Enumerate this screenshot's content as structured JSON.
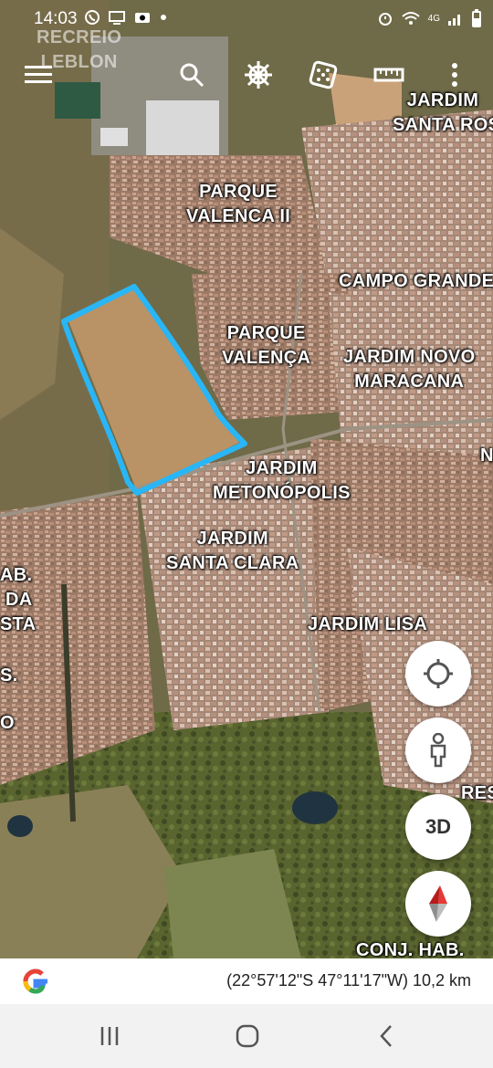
{
  "status_bar": {
    "time": "14:03",
    "left_icons": [
      "whatsapp-icon",
      "cast-icon",
      "camera-icon",
      "dot-icon"
    ],
    "right_icons": [
      "alarm-icon",
      "wifi-icon",
      "4g-signal-icon",
      "signal-icon",
      "battery-icon"
    ],
    "network": "4G"
  },
  "toolbar": {
    "items": [
      "menu-icon",
      "search-icon",
      "voyager-wheel-icon",
      "feeling-lucky-dice-icon",
      "measure-ruler-icon",
      "more-vert-icon"
    ]
  },
  "map_labels": [
    {
      "id": "recreio-leblon",
      "lines": [
        "RECREIO",
        "LEBLON"
      ]
    },
    {
      "id": "jardim-santa-rosa",
      "lines": [
        "JARDIM",
        "SANTA ROS"
      ]
    },
    {
      "id": "parque-valenca-ii",
      "lines": [
        "PARQUE",
        "VALENCA II"
      ]
    },
    {
      "id": "campo-grande",
      "lines": [
        "CAMPO GRANDE"
      ]
    },
    {
      "id": "parque-valenca",
      "lines": [
        "PARQUE",
        "VALENÇA"
      ]
    },
    {
      "id": "jardim-novo-maracana",
      "lines": [
        "JARDIM NOVO",
        "MARACANA"
      ]
    },
    {
      "id": "n-right",
      "lines": [
        "N"
      ]
    },
    {
      "id": "jardim-metonopolis",
      "lines": [
        "JARDIM",
        "METONÓPOLIS"
      ]
    },
    {
      "id": "jardim-santa-clara",
      "lines": [
        "JARDIM",
        "SANTA CLARA"
      ]
    },
    {
      "id": "hab-da-sta",
      "lines": [
        "AB.",
        "DA",
        "STA"
      ]
    },
    {
      "id": "jardim-lisa",
      "lines": [
        "JARDIM LISA"
      ]
    },
    {
      "id": "s-left",
      "lines": [
        "S."
      ]
    },
    {
      "id": "o-left",
      "lines": [
        "O"
      ]
    },
    {
      "id": "res-right",
      "lines": [
        "RES"
      ]
    },
    {
      "id": "conj-hab",
      "lines": [
        "CONJ. HAB."
      ]
    }
  ],
  "controls": {
    "locate": "crosshair-icon",
    "street_view": "pegman-icon",
    "view_3d": "3D",
    "compass": "compass-icon"
  },
  "info_bar": {
    "logo": "google-g-logo",
    "coordinates": "(22°57'12\"S 47°11'17\"W) 10,2 km"
  },
  "nav_bar": {
    "buttons": [
      "recent-apps-icon",
      "home-icon",
      "back-icon"
    ]
  },
  "colors": {
    "outline": "#29b6f6",
    "urban": "#a9866f",
    "vegetation": "#5f6b3a",
    "dirt": "#c9a26e"
  }
}
